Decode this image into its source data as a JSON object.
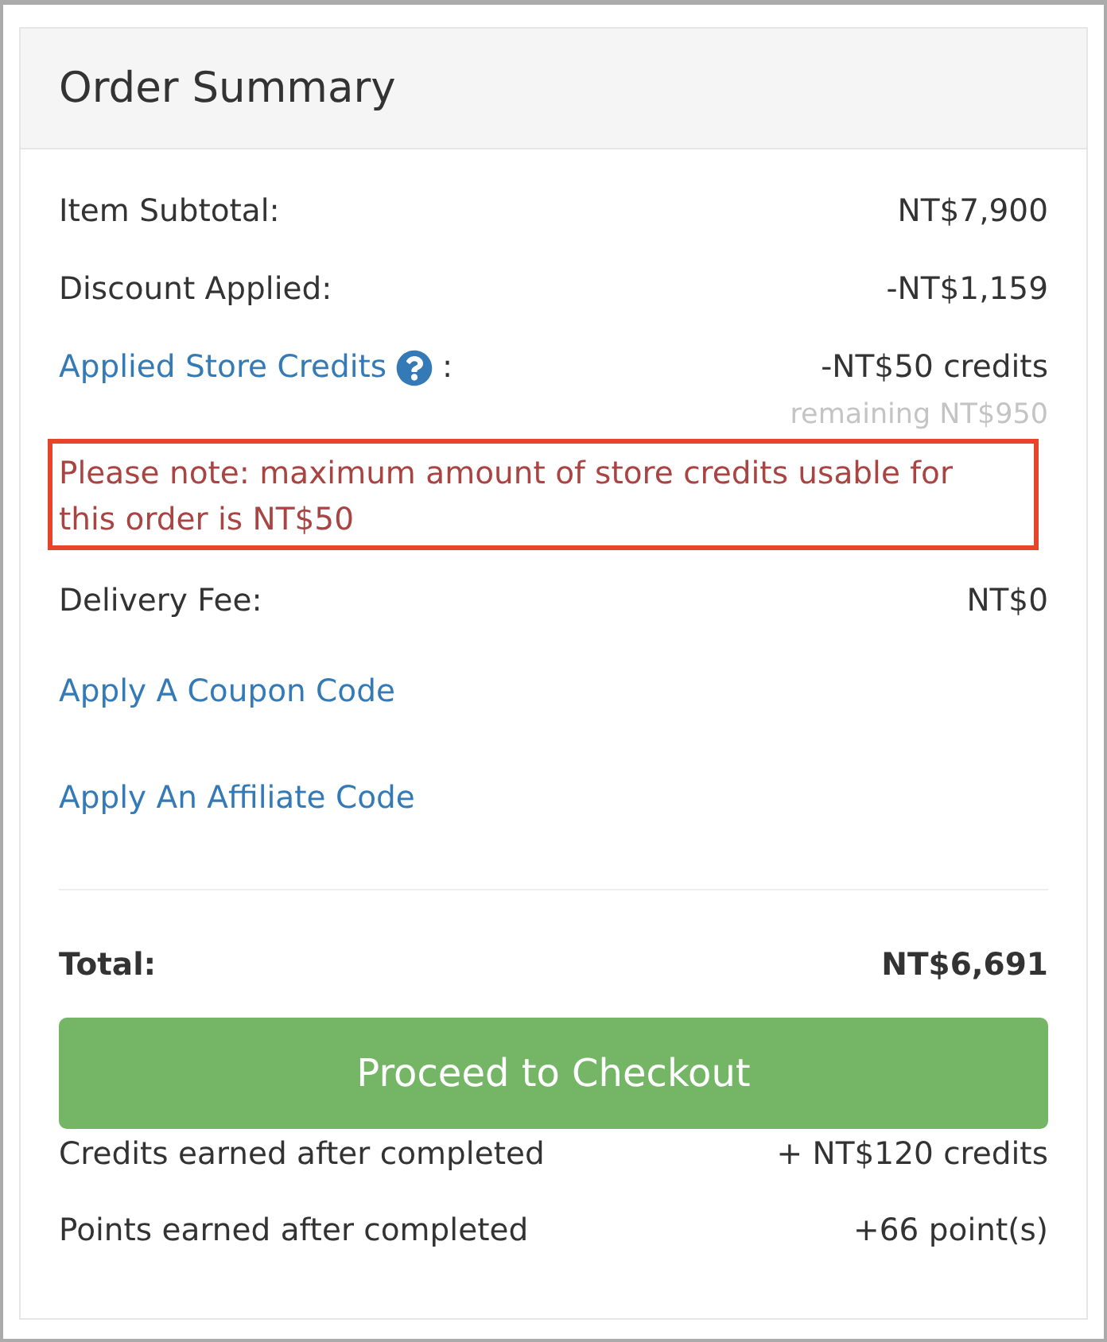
{
  "summary": {
    "title": "Order Summary"
  },
  "rows": [
    {
      "label": "Item Subtotal:",
      "value": "NT$7,900"
    },
    {
      "label": "Discount Applied:",
      "value": "-NT$1,159"
    }
  ],
  "store_credits": {
    "label": "Applied Store Credits",
    "separator": ":",
    "value": "-NT$50 credits",
    "remaining": "remaining NT$950"
  },
  "notice": "Please note: maximum amount of store credits usable for this order is NT$50",
  "delivery": {
    "label": "Delivery Fee:",
    "value": "NT$0"
  },
  "links": [
    "Apply A Coupon Code",
    "Apply An Affiliate Code"
  ],
  "total": {
    "label": "Total:",
    "value": "NT$6,691"
  },
  "checkout_button": "Proceed to Checkout",
  "earnings": [
    {
      "label": "Credits earned after completed",
      "value": "+ NT$120 credits"
    },
    {
      "label": "Points earned after completed",
      "value": "+66 point(s)"
    }
  ]
}
